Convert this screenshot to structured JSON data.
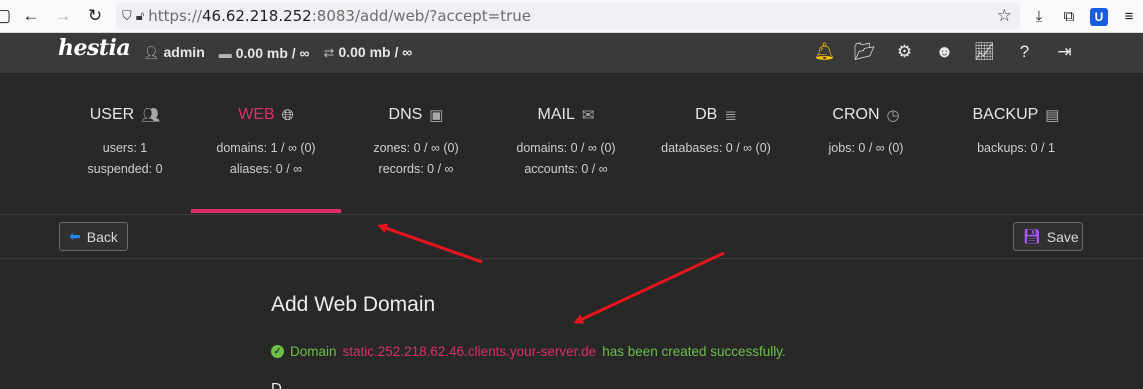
{
  "browser": {
    "url_prefix": "https://",
    "url_host": "46.62.218.252",
    "url_rest": ":8083/add/web/?accept=true"
  },
  "topbar": {
    "logo": "hestia",
    "user": "admin",
    "disk": "0.00 mb / ∞",
    "bandwidth": "0.00 mb / ∞"
  },
  "tabs": [
    {
      "title": "USER",
      "icon": "users-icon",
      "stats": [
        "users: 1",
        "suspended: 0"
      ]
    },
    {
      "title": "WEB",
      "icon": "globe-icon",
      "stats": [
        "domains: 1 / ∞ (0)",
        "aliases: 0 / ∞"
      ]
    },
    {
      "title": "DNS",
      "icon": "dns-book-icon",
      "stats": [
        "zones: 0 / ∞ (0)",
        "records: 0 / ∞"
      ]
    },
    {
      "title": "MAIL",
      "icon": "mail-icon",
      "stats": [
        "domains: 0 / ∞ (0)",
        "accounts: 0 / ∞"
      ]
    },
    {
      "title": "DB",
      "icon": "database-icon",
      "stats": [
        "databases: 0 / ∞ (0)"
      ]
    },
    {
      "title": "CRON",
      "icon": "clock-icon",
      "stats": [
        "jobs: 0 / ∞ (0)"
      ]
    },
    {
      "title": "BACKUP",
      "icon": "file-archive-icon",
      "stats": [
        "backups: 0 / 1"
      ]
    }
  ],
  "active_tab": "WEB",
  "toolbar": {
    "back_label": "Back",
    "save_label": "Save"
  },
  "main": {
    "title": "Add Web Domain",
    "alert_prefix": "Domain",
    "alert_domain": "static.252.218.62.46.clients.your-server.de",
    "alert_suffix": "has been created successfully.",
    "cut_label": "D"
  },
  "colors": {
    "accent": "#d92f6b",
    "success": "#6cc04a",
    "annotation": "#e8141b"
  }
}
